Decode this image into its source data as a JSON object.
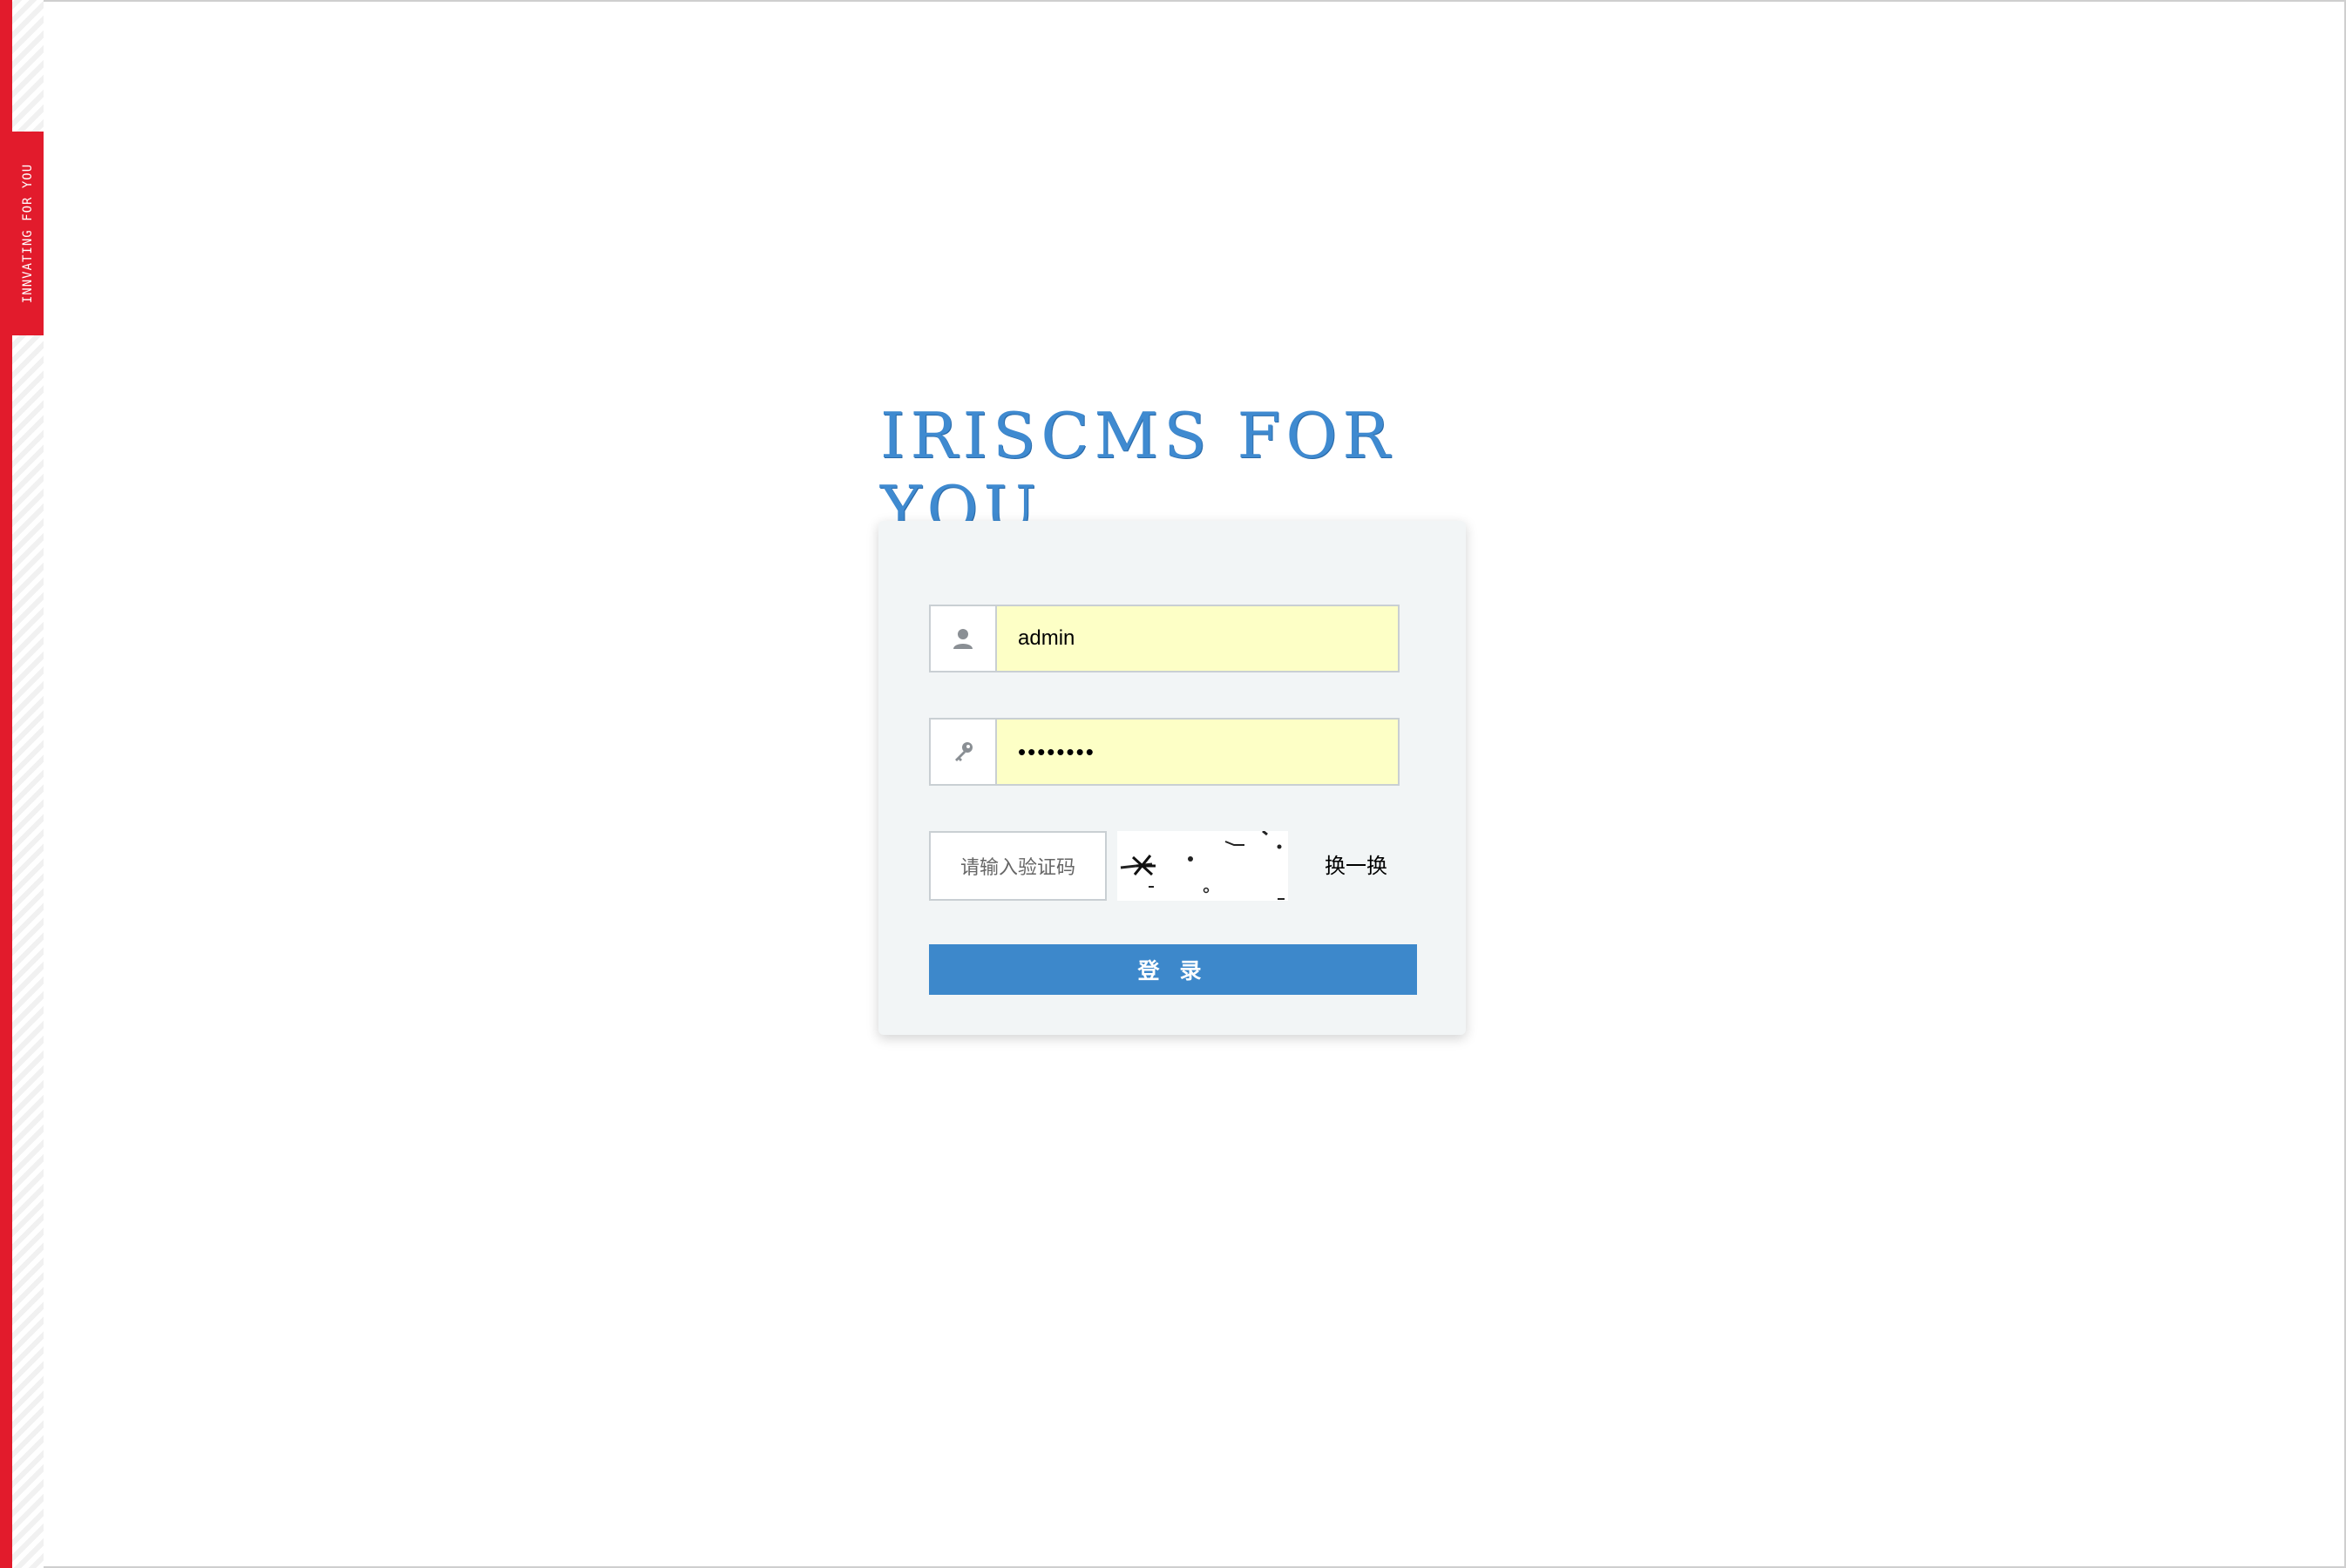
{
  "sidebar": {
    "tag_text": "INNVATING FOR YOU",
    "accent_color": "#e21b2c"
  },
  "logo": {
    "text": "IRISCMS FOR YOU",
    "color": "#3f8ad0"
  },
  "login": {
    "username_value": "admin",
    "password_value": "••••••••",
    "username_icon": "user-icon",
    "password_icon": "key-icon",
    "captcha_placeholder": "请输入验证码",
    "refresh_label": "换一换",
    "submit_label": "登 录",
    "input_autofill_color": "#fdffc6",
    "button_color": "#3d88cb"
  }
}
